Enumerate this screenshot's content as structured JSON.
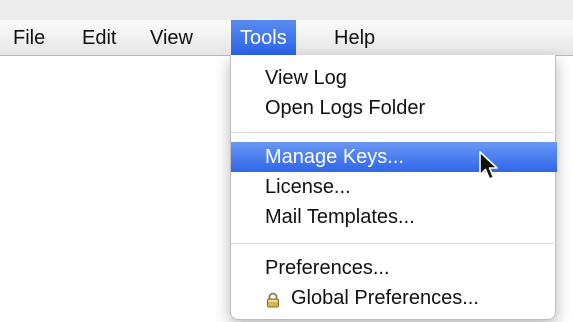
{
  "menubar": {
    "items": [
      {
        "label": "File"
      },
      {
        "label": "Edit"
      },
      {
        "label": "View"
      },
      {
        "label": "Tools"
      },
      {
        "label": "Help"
      }
    ],
    "active_index": 3,
    "accent_color": "#2f66ea"
  },
  "tools_menu": {
    "items": [
      {
        "label": "View Log"
      },
      {
        "label": "Open Logs Folder"
      },
      {
        "label": "Manage Keys..."
      },
      {
        "label": "License..."
      },
      {
        "label": "Mail Templates..."
      },
      {
        "label": "Preferences..."
      },
      {
        "label": "Global Preferences...",
        "icon": "lock-icon"
      }
    ],
    "highlighted_index": 2
  },
  "pointer": {
    "icon": "arrow-cursor-icon"
  }
}
